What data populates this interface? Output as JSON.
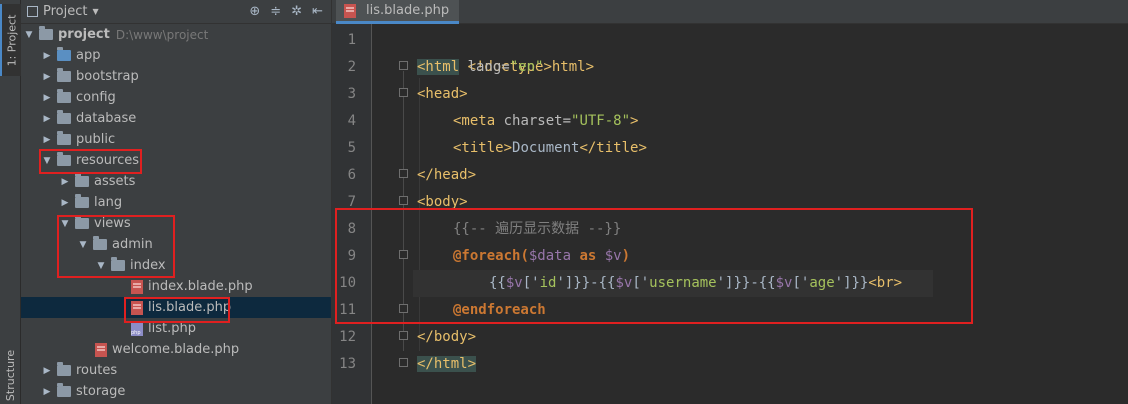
{
  "toolstrip": {
    "project_tab": "1: Project",
    "structure_tab": "Structure"
  },
  "project_panel": {
    "title": "Project",
    "title_arrow": "▼",
    "toolbar_icons": [
      "crosshair-icon",
      "collapse-icon",
      "gear-icon",
      "hide-icon"
    ],
    "root": {
      "name": "project",
      "path": "D:\\www\\project"
    },
    "tree": [
      {
        "label": "app",
        "kind": "folder",
        "depth": 1,
        "expanded": false
      },
      {
        "label": "bootstrap",
        "kind": "folder",
        "depth": 1,
        "expanded": false
      },
      {
        "label": "config",
        "kind": "folder",
        "depth": 1,
        "expanded": false
      },
      {
        "label": "database",
        "kind": "folder",
        "depth": 1,
        "expanded": false
      },
      {
        "label": "public",
        "kind": "folder",
        "depth": 1,
        "expanded": false
      },
      {
        "label": "resources",
        "kind": "folder",
        "depth": 1,
        "expanded": true
      },
      {
        "label": "assets",
        "kind": "folder",
        "depth": 2,
        "expanded": false
      },
      {
        "label": "lang",
        "kind": "folder",
        "depth": 2,
        "expanded": false
      },
      {
        "label": "views",
        "kind": "folder",
        "depth": 2,
        "expanded": true
      },
      {
        "label": "admin",
        "kind": "folder",
        "depth": 3,
        "expanded": true
      },
      {
        "label": "index",
        "kind": "folder",
        "depth": 4,
        "expanded": true
      },
      {
        "label": "index.blade.php",
        "kind": "blade",
        "depth": 5
      },
      {
        "label": "lis.blade.php",
        "kind": "blade",
        "depth": 5,
        "selected": true
      },
      {
        "label": "list.php",
        "kind": "php",
        "depth": 5
      },
      {
        "label": "welcome.blade.php",
        "kind": "blade",
        "depth": 4
      },
      {
        "label": "routes",
        "kind": "folder",
        "depth": 1,
        "expanded": false
      },
      {
        "label": "storage",
        "kind": "folder",
        "depth": 1,
        "expanded": false
      }
    ]
  },
  "editor": {
    "active_tab": "lis.blade.php",
    "line_numbers": [
      "1",
      "2",
      "3",
      "4",
      "5",
      "6",
      "7",
      "8",
      "9",
      "10",
      "11",
      "12",
      "13"
    ],
    "code": {
      "l1": "<!doctype html>",
      "l2_open": "<html",
      "l2_attr": " lang=",
      "l2_val": "\"en\"",
      "l2_close": ">",
      "l3": "<head>",
      "l4_open": "<meta",
      "l4_attr": " charset=",
      "l4_val": "\"UTF-8\"",
      "l4_close": ">",
      "l5_open": "<title>",
      "l5_text": "Document",
      "l5_close": "</title>",
      "l6": "</head>",
      "l7": "<body>",
      "l8": "{{-- 遍历显示数据 --}}",
      "l9_kw": "@foreach",
      "l9_p1": "(",
      "l9_var1": "$data",
      "l9_as": " as ",
      "l9_var2": "$v",
      "l9_p2": ")",
      "l10_a": "{{",
      "l10_v1": "$v",
      "l10_k1": "['",
      "l10_s1": "id",
      "l10_k2": "']",
      "l10_b": "}}-{{",
      "l10_v2": "$v",
      "l10_k3": "['",
      "l10_s2": "username",
      "l10_k4": "']",
      "l10_c": "}}-{{",
      "l10_v3": "$v",
      "l10_k5": "['",
      "l10_s3": "age",
      "l10_k6": "']",
      "l10_d": "}}",
      "l10_br": "<br>",
      "l11": "@endforeach",
      "l12": "</body>",
      "l13": "</html>"
    }
  },
  "colors": {
    "highlight_box": "#e02020",
    "selection": "#0d293e",
    "tag": "#e8bf6a",
    "keyword": "#cc7832",
    "variable": "#9876aa",
    "string": "#a5c25c",
    "comment": "#808080"
  }
}
